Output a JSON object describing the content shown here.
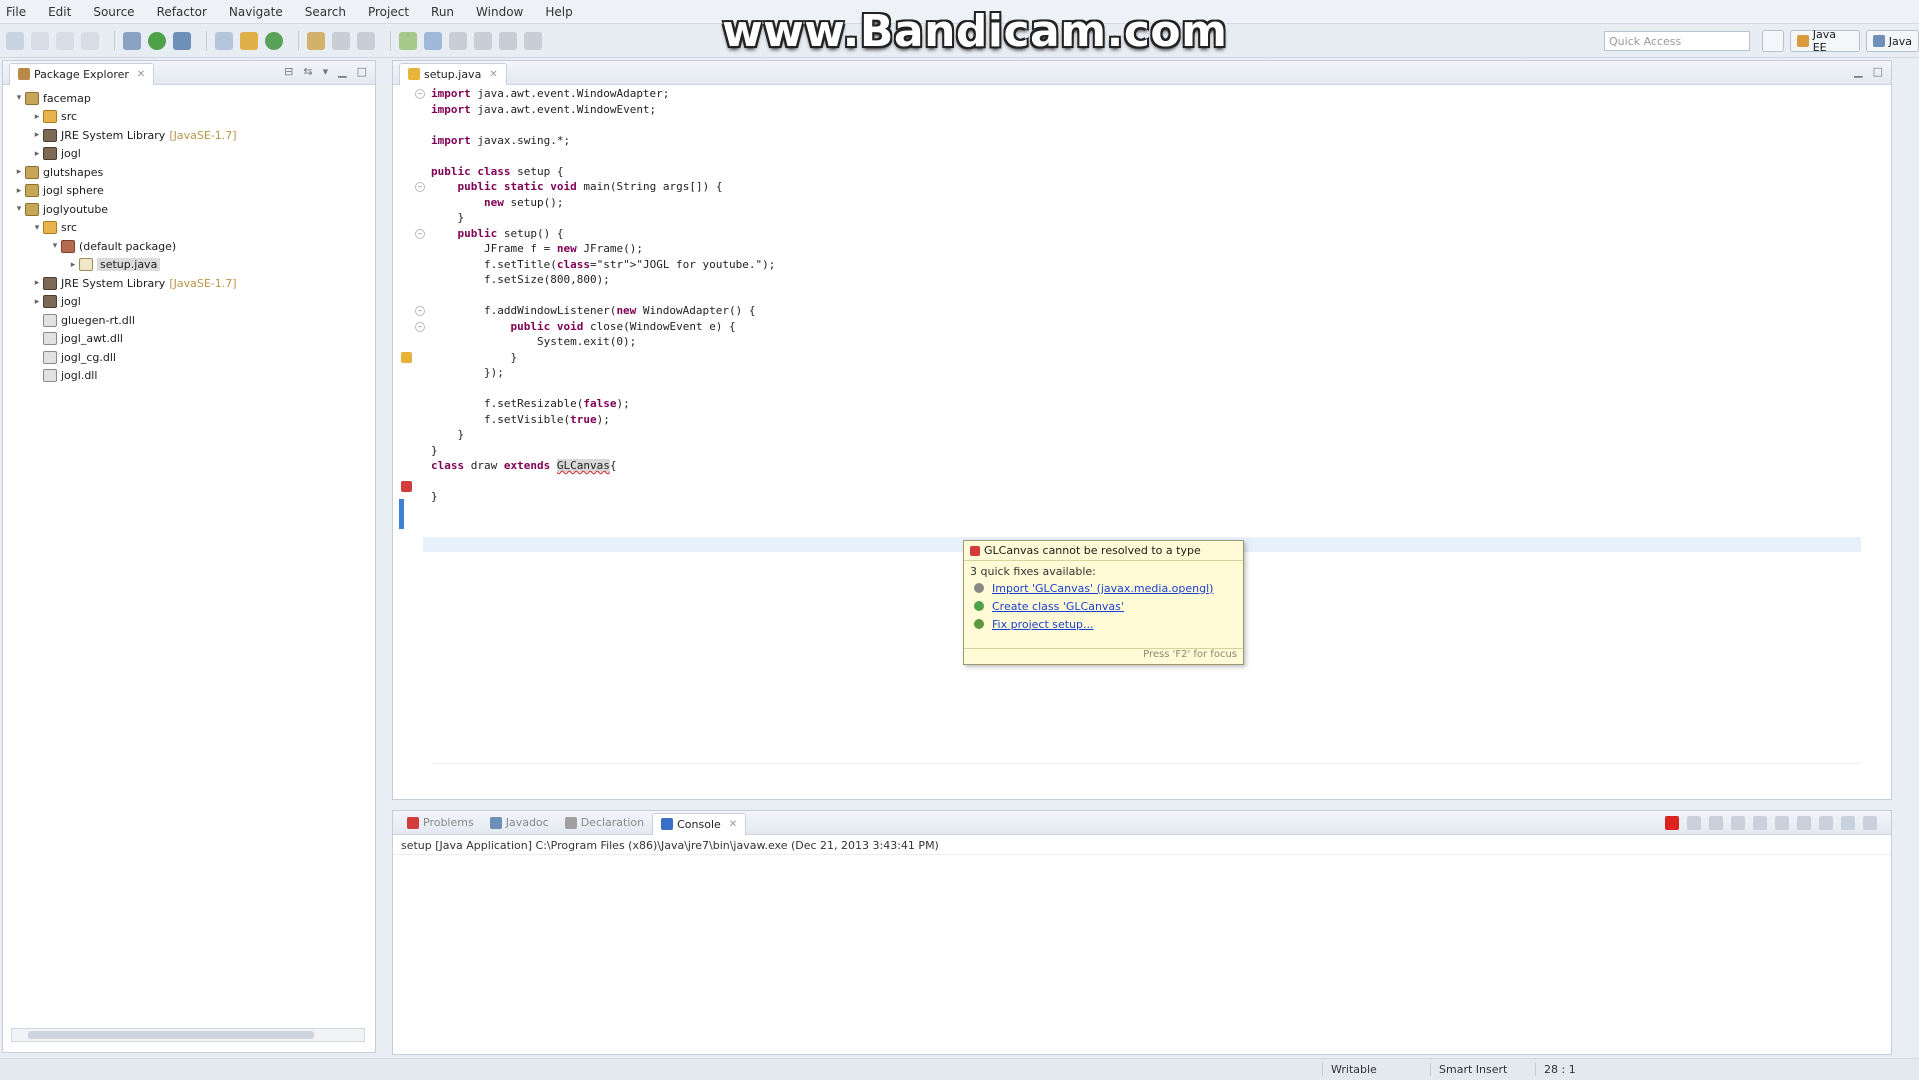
{
  "menubar": [
    "File",
    "Edit",
    "Source",
    "Refactor",
    "Navigate",
    "Search",
    "Project",
    "Run",
    "Window",
    "Help"
  ],
  "watermark": "www.Bandicam.com",
  "quick_access_placeholder": "Quick Access",
  "perspectives": [
    "Java EE",
    "Java"
  ],
  "package_explorer": {
    "tab_label": "Package Explorer",
    "tree": [
      {
        "label": "facemap",
        "icon": "project-icon",
        "indent": 0,
        "arrow": "▾"
      },
      {
        "label": "src",
        "icon": "src-folder-icon",
        "indent": 1,
        "arrow": "▸"
      },
      {
        "label": "JRE System Library",
        "extra": "[JavaSE-1.7]",
        "icon": "library-icon",
        "indent": 1,
        "arrow": "▸"
      },
      {
        "label": "jogl",
        "icon": "library-icon",
        "indent": 1,
        "arrow": "▸"
      },
      {
        "label": "glutshapes",
        "icon": "project-icon",
        "indent": 0,
        "arrow": "▸"
      },
      {
        "label": "jogl sphere",
        "icon": "project-icon",
        "indent": 0,
        "arrow": "▸"
      },
      {
        "label": "joglyoutube",
        "icon": "project-icon",
        "indent": 0,
        "arrow": "▾"
      },
      {
        "label": "src",
        "icon": "src-folder-icon",
        "indent": 1,
        "arrow": "▾"
      },
      {
        "label": "(default package)",
        "icon": "package-icon",
        "indent": 2,
        "arrow": "▾"
      },
      {
        "label": "setup.java",
        "icon": "java-file-icon",
        "indent": 3,
        "arrow": "▸",
        "selected": true
      },
      {
        "label": "JRE System Library",
        "extra": "[JavaSE-1.7]",
        "icon": "library-icon",
        "indent": 1,
        "arrow": "▸"
      },
      {
        "label": "jogl",
        "icon": "library-icon",
        "indent": 1,
        "arrow": "▸"
      },
      {
        "label": "gluegen-rt.dll",
        "icon": "dll-file-icon",
        "indent": 1,
        "arrow": ""
      },
      {
        "label": "jogl_awt.dll",
        "icon": "dll-file-icon",
        "indent": 1,
        "arrow": ""
      },
      {
        "label": "jogl_cg.dll",
        "icon": "dll-file-icon",
        "indent": 1,
        "arrow": ""
      },
      {
        "label": "jogl.dll",
        "icon": "dll-file-icon",
        "indent": 1,
        "arrow": ""
      }
    ]
  },
  "editor": {
    "tab_label": "setup.java",
    "lines": [
      "import java.awt.event.WindowAdapter;",
      "import java.awt.event.WindowEvent;",
      "",
      "import javax.swing.*;",
      "",
      "public class setup {",
      "    public static void main(String args[]) {",
      "        new setup();",
      "    }",
      "    public setup() {",
      "        JFrame f = new JFrame();",
      "        f.setTitle(\"JOGL for youtube.\");",
      "        f.setSize(800,800);",
      "",
      "        f.addWindowListener(new WindowAdapter() {",
      "            public void close(WindowEvent e) {",
      "                System.exit(0);",
      "            }",
      "        });",
      "",
      "        f.setResizable(false);",
      "        f.setVisible(true);",
      "    }",
      "}",
      "class draw extends GLCanvas{",
      "",
      "}",
      "",
      ""
    ]
  },
  "quickfix": {
    "title": "GLCanvas cannot be resolved to a type",
    "subtitle": "3 quick fixes available:",
    "items": [
      {
        "label": "Import 'GLCanvas' (javax.media.opengl)",
        "icon": "import-icon"
      },
      {
        "label": "Create class 'GLCanvas'",
        "icon": "create-class-icon"
      },
      {
        "label": "Fix project setup...",
        "icon": "fix-setup-icon"
      }
    ],
    "footer": "Press 'F2' for focus"
  },
  "bottom_tabs": [
    "Problems",
    "Javadoc",
    "Declaration",
    "Console"
  ],
  "console": {
    "header": "setup [Java Application] C:\\Program Files (x86)\\Java\\jre7\\bin\\javaw.exe (Dec 21, 2013 3:43:41 PM)"
  },
  "statusbar": {
    "writable": "Writable",
    "insert_mode": "Smart Insert",
    "position": "28 : 1"
  }
}
